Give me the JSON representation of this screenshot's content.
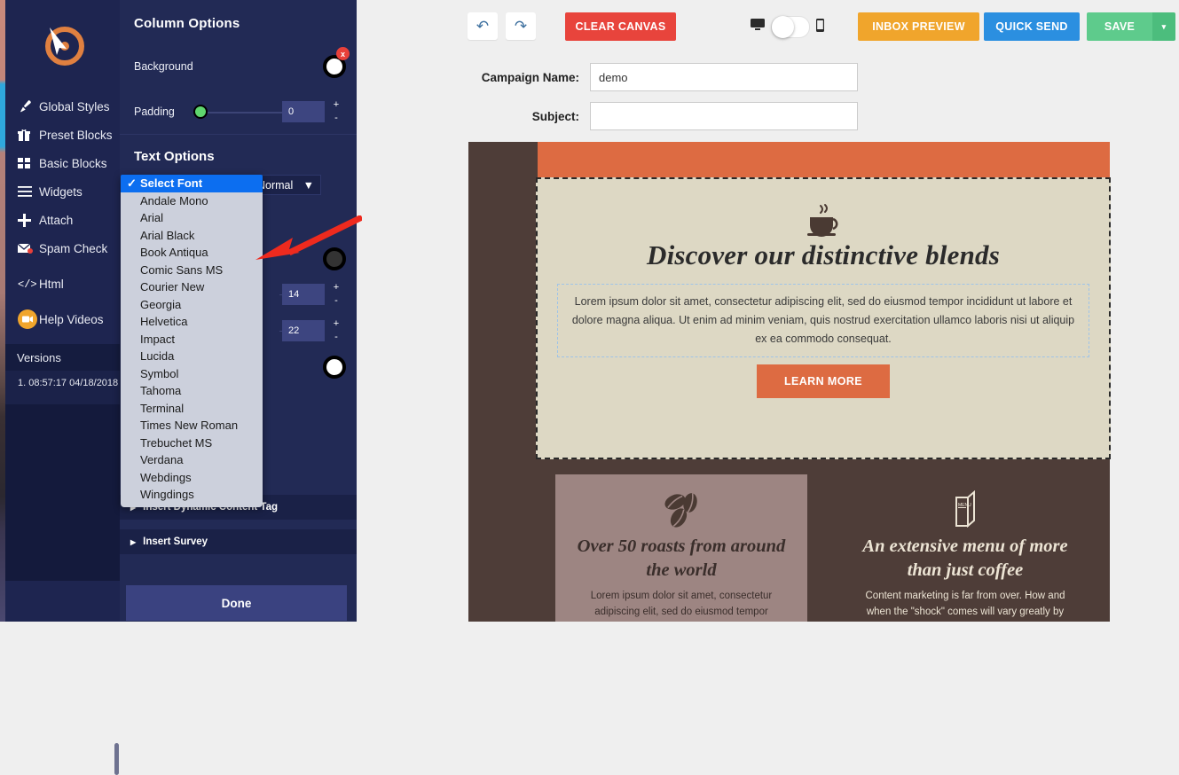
{
  "app": {
    "logo_name": "target-cursor-logo"
  },
  "sidebar": {
    "items": [
      {
        "label": "Global Styles",
        "icon": "brush-icon",
        "name": "sidebar-item-global-styles"
      },
      {
        "label": "Preset Blocks",
        "icon": "gift-icon",
        "name": "sidebar-item-preset-blocks"
      },
      {
        "label": "Basic Blocks",
        "icon": "grid-icon",
        "name": "sidebar-item-basic-blocks"
      },
      {
        "label": "Widgets",
        "icon": "hamburger-icon",
        "name": "sidebar-item-widgets"
      },
      {
        "label": "Attach",
        "icon": "plus-icon",
        "name": "sidebar-item-attach"
      },
      {
        "label": "Spam Check",
        "icon": "envelope-icon",
        "name": "sidebar-item-spam-check"
      },
      {
        "label": "Html",
        "icon": "code-icon",
        "name": "sidebar-item-html"
      },
      {
        "label": "Help Videos",
        "icon": "video-camera-icon",
        "name": "sidebar-item-help-videos"
      }
    ],
    "versions_header": "Versions",
    "versions": [
      "1. 08:57:17 04/18/2018"
    ]
  },
  "panel": {
    "column_options_title": "Column Options",
    "background_label": "Background",
    "background_color": "#ffffff",
    "background_clear": "x",
    "padding_label": "Padding",
    "padding_value": "0",
    "padding_plus": "+",
    "padding_minus": "-",
    "text_options_title": "Text Options",
    "font_weight_value": "Normal",
    "text_color": "#333333",
    "font_size_value": "14",
    "line_height_value": "22",
    "second_color": "#ffffff",
    "spin_plus": "+",
    "spin_minus": "-",
    "collapse_rows": [
      {
        "label": "Insert Dynamic Content Tag",
        "name": "insert-dynamic-content-tag-row"
      },
      {
        "label": "Insert Survey",
        "name": "insert-survey-row"
      }
    ],
    "done_label": "Done"
  },
  "font_dropdown": {
    "selected": "Select Font",
    "options": [
      "Select Font",
      "Andale Mono",
      "Arial",
      "Arial Black",
      "Book Antiqua",
      "Comic Sans MS",
      "Courier New",
      "Georgia",
      "Helvetica",
      "Impact",
      "Lucida",
      "Symbol",
      "Tahoma",
      "Terminal",
      "Times New Roman",
      "Trebuchet MS",
      "Verdana",
      "Webdings",
      "Wingdings"
    ]
  },
  "toolbar": {
    "undo_icon": "undo-icon",
    "redo_icon": "redo-icon",
    "clear_canvas_label": "CLEAR CANVAS",
    "desktop_icon": "desktop-icon",
    "mobile_icon": "mobile-icon",
    "inbox_preview_label": "INBOX PREVIEW",
    "quick_send_label": "QUICK SEND",
    "save_label": "SAVE",
    "save_caret": "▾"
  },
  "form": {
    "campaign_name_label": "Campaign Name:",
    "campaign_name_value": "demo",
    "campaign_name_placeholder": "",
    "subject_label": "Subject:",
    "subject_value": "",
    "subject_placeholder": ""
  },
  "email": {
    "hero": {
      "icon": "coffee-cup-icon",
      "heading": "Discover our distinctive blends",
      "paragraph": "Lorem ipsum dolor sit amet, consectetur adipiscing elit, sed do eiusmod tempor incididunt ut labore et dolore magna aliqua. Ut enim ad minim veniam, quis nostrud exercitation ullamco laboris nisi ut aliquip ex ea commodo consequat.",
      "button_label": "LEARN MORE"
    },
    "cards": [
      {
        "icon": "coffee-beans-icon",
        "heading": "Over 50 roasts from around the world",
        "paragraph": "Lorem ipsum dolor sit amet, consectetur adipiscing elit, sed do eiusmod tempor"
      },
      {
        "icon": "menu-card-icon",
        "heading": "An extensive menu of more than just coffee",
        "paragraph": "Content marketing is far from over. How and when the \"shock\" comes will vary greatly by"
      }
    ]
  },
  "colors": {
    "sidebar_bg": "#1e2550",
    "panel_bg": "#222a55",
    "accent_orange": "#dd6b42",
    "clear_red": "#e8443c",
    "inbox_orange": "#f0a52c",
    "quick_blue": "#2b8fe0",
    "save_green": "#5ecb8c",
    "email_dark": "#4e3d38",
    "hero_cream": "#ddd8c4",
    "card_mauve": "#9d8582"
  }
}
